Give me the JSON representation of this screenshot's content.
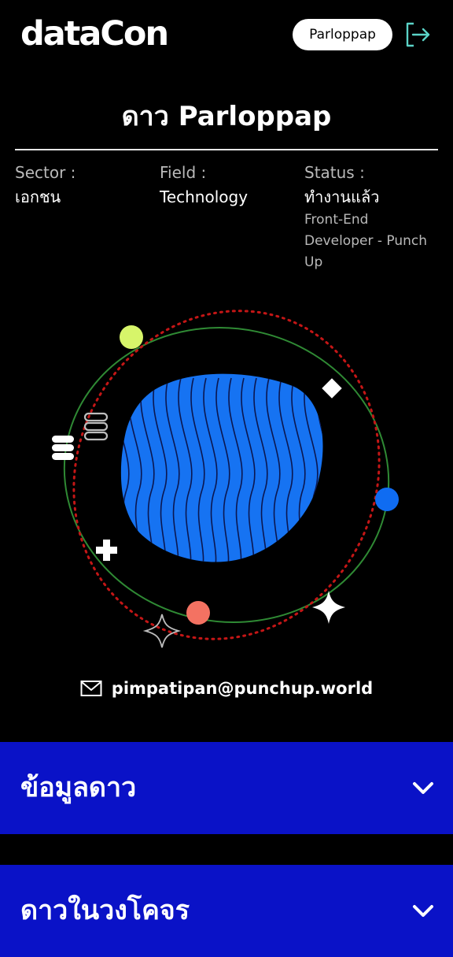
{
  "header": {
    "logo": "dataCon",
    "username": "Parloppap"
  },
  "profile": {
    "title": "ดาว Parloppap",
    "sector_label": "Sector :",
    "sector_value": "เอกชน",
    "field_label": "Field :",
    "field_value": "Technology",
    "status_label": "Status :",
    "status_value": "ทำงานแล้ว",
    "status_detail": "Front-End Developer - Punch Up",
    "email": "pimpatipan@punchup.world"
  },
  "sections": [
    {
      "title": "ข้อมูลดาว"
    },
    {
      "title": "ดาวในวงโคจร"
    }
  ],
  "colors": {
    "background": "#000000",
    "accordion": "#0a12c7",
    "planet": "#1673f2",
    "orbit_green": "#2f8a34",
    "orbit_red": "#c41616",
    "moon_lime": "#d7f56a",
    "moon_blue": "#0f6cf2",
    "moon_coral": "#f47262"
  },
  "icons": [
    "logout-icon",
    "mail-icon",
    "chevron-down-icon",
    "sparkle-icon",
    "plus-icon",
    "diamond-icon"
  ]
}
